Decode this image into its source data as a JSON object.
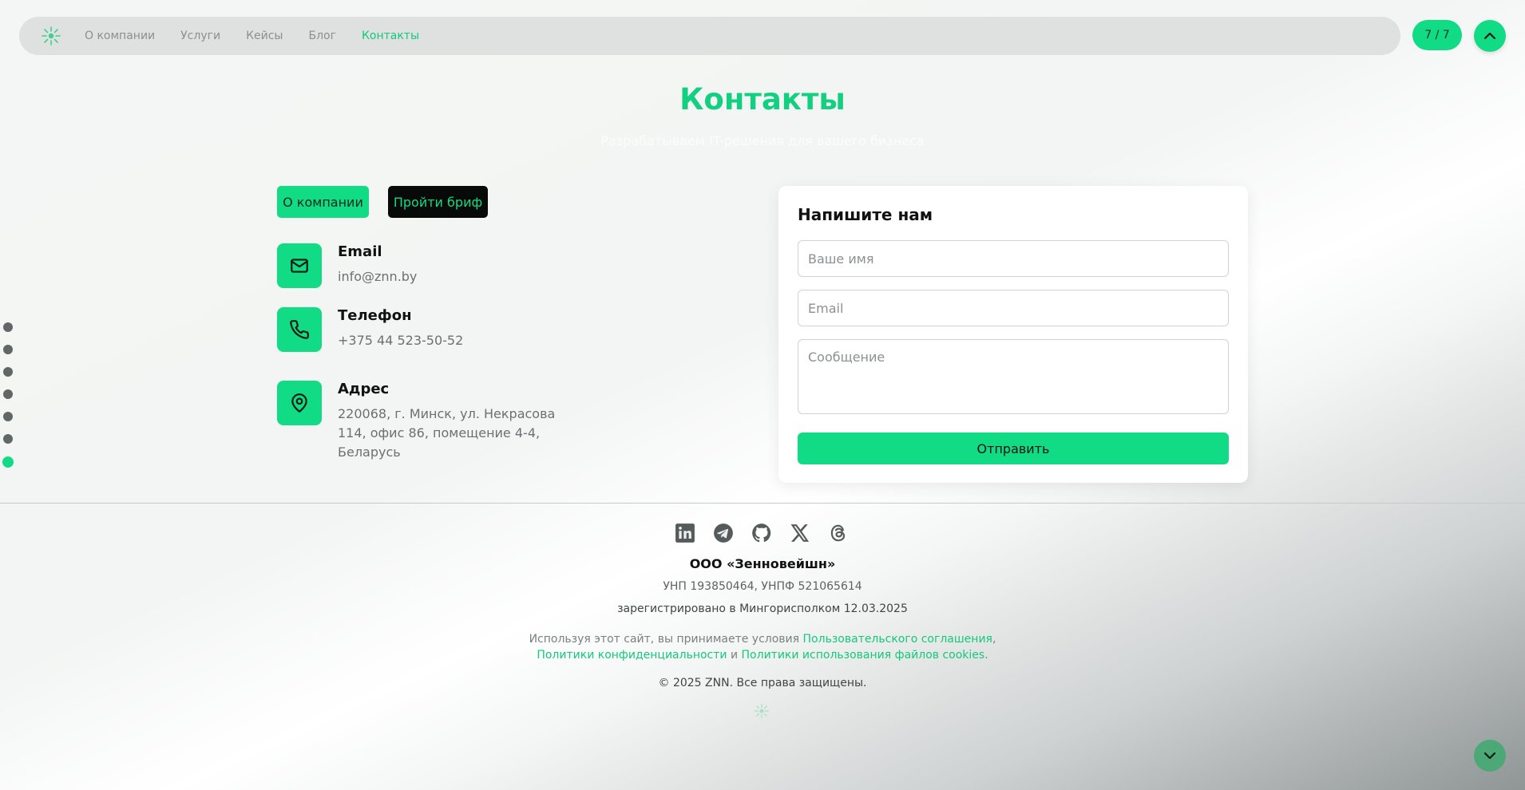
{
  "nav": {
    "logo_icon": "sun-burst-logo",
    "items": [
      {
        "label": "О компании"
      },
      {
        "label": "Услуги"
      },
      {
        "label": "Кейсы"
      },
      {
        "label": "Блог"
      },
      {
        "label": "Контакты",
        "active": true
      }
    ],
    "page_indicator": "7 / 7",
    "scroll_up_icon": "chevron-up-icon"
  },
  "section": {
    "title": "Контакты",
    "subtitle": "Разрабатываем IT-решения для вашего бизнеса"
  },
  "section_dots": {
    "count": 7,
    "active_index": 6
  },
  "actions": {
    "about_label": "О компании",
    "brief_label": "Пройти бриф"
  },
  "contacts": [
    {
      "icon": "mail-icon",
      "label": "Email",
      "value": "info@znn.by"
    },
    {
      "icon": "phone-icon",
      "label": "Телефон",
      "value": "+375 44 523-50-52"
    },
    {
      "icon": "location-pin-icon",
      "label": "Адрес",
      "value": "220068, г. Минск, ул. Некрасова 114, офис 86, помещение 4-4, Беларусь"
    }
  ],
  "form": {
    "title": "Напишите нам",
    "name_placeholder": "Ваше имя",
    "email_placeholder": "Email",
    "message_placeholder": "Сообщение",
    "submit_label": "Отправить"
  },
  "footer": {
    "socials": [
      "linkedin-icon",
      "telegram-icon",
      "github-icon",
      "x-icon",
      "threads-icon"
    ],
    "company": "ООО «Зенновейшн»",
    "unp": "УНП 193850464, УНПФ 521065614",
    "registration": "зарегистрировано в Мингорисполком 12.03.2025",
    "terms_prefix": "Используя этот сайт, вы принимаете условия",
    "terms_link1": "Пользовательского соглашения",
    "terms_sep": ",",
    "terms_link2": "Политики конфиденциальности",
    "terms_and": "и",
    "terms_link3": "Политики использования файлов cookies",
    "terms_end": ".",
    "copyright": "© 2025 ZNN. Все права защищены."
  },
  "colors": {
    "accent": "#11db85",
    "accent_text": "#12d07f",
    "dark_button": "#070a09",
    "dot_inactive": "#616767"
  }
}
